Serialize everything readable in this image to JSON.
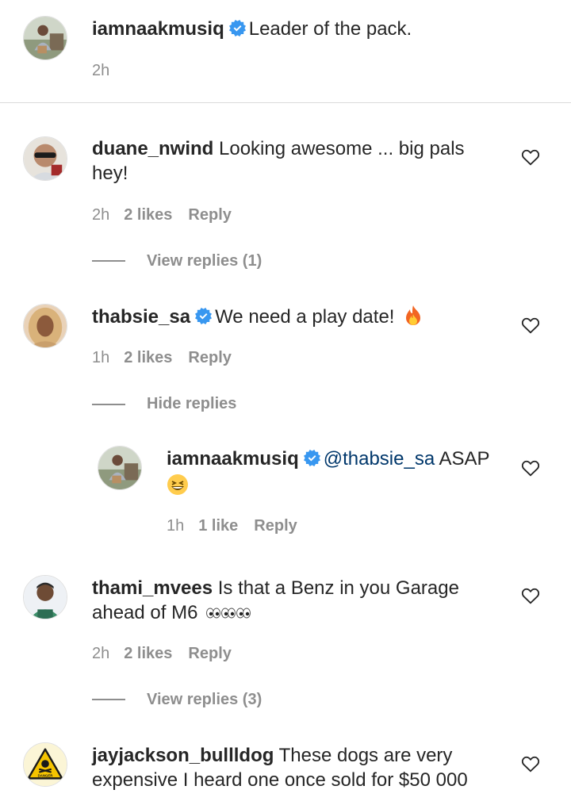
{
  "caption": {
    "username": "iamnaakmusiq",
    "text": "Leader of the pack.",
    "time": "2h"
  },
  "comments": [
    {
      "username": "duane_nwind",
      "text_line1": "Looking awesome ... big pals",
      "text_line2": "hey!",
      "time": "2h",
      "likes": "2 likes",
      "reply": "Reply",
      "replies_toggle": "View replies (1)"
    },
    {
      "username": "thabsie_sa",
      "text": "We need a play date!",
      "emoji": "fire",
      "time": "1h",
      "likes": "2 likes",
      "reply": "Reply",
      "replies_toggle": "Hide replies",
      "replies": [
        {
          "username": "iamnaakmusiq",
          "mention": "@thabsie_sa",
          "text": "ASAP",
          "emoji": "grinning-squinting-face",
          "time": "1h",
          "likes": "1 like",
          "reply": "Reply"
        }
      ]
    },
    {
      "username": "thami_mvees",
      "text_line1": "Is that a Benz in you Garage",
      "text_line2": "ahead of M6",
      "emoji": "eyes x4",
      "time": "2h",
      "likes": "2 likes",
      "reply": "Reply",
      "replies_toggle": "View replies (3)"
    },
    {
      "username": "jayjackson_bullldog",
      "text_line1": "These dogs are very",
      "text_line2": "expensive I heard one once sold for $50 000"
    }
  ],
  "avatar_danger_sign": "DANGER",
  "colors": {
    "text": "#262626",
    "secondary": "#8e8e8e",
    "verified": "#3897f0",
    "mention": "#00376b",
    "divider": "#dbdbdb"
  }
}
